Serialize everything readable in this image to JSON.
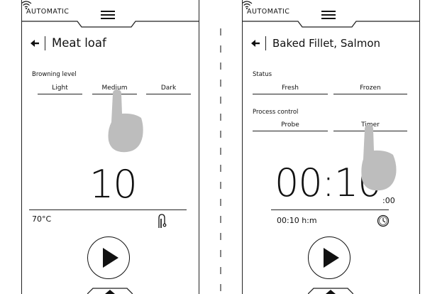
{
  "left": {
    "mode": "AUTOMATIC",
    "title": "Meat loaf",
    "section": "Browning level",
    "options": [
      "Light",
      "Medium",
      "Dark"
    ],
    "value": "10",
    "temperature": "70°C"
  },
  "right": {
    "mode": "AUTOMATIC",
    "title": "Baked Fillet, Salmon",
    "status_label": "Status",
    "status_options": [
      "Fresh",
      "Frozen"
    ],
    "process_label": "Process control",
    "process_options": [
      "Probe",
      "Timer"
    ],
    "timer_main": "00:10",
    "timer_seconds": ":00",
    "timer_readout": "00:10 h:m"
  },
  "icons": {
    "menu": "hamburger-icon",
    "wifi": "wifi-icon",
    "back": "back-arrow-icon",
    "probe": "meat-probe-icon",
    "clock": "clock-icon",
    "play": "play-icon",
    "hand": "pointing-hand-icon"
  }
}
